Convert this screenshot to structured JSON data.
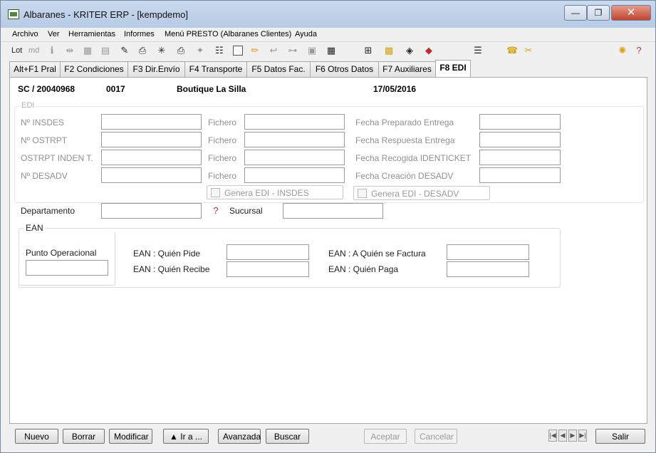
{
  "window": {
    "title": "Albaranes - KRITER ERP -  [kempdemo]",
    "minimize_glyph": "—",
    "restore_glyph": "❐",
    "close_glyph": "✕"
  },
  "menu": [
    "Archivo",
    "Ver",
    "Herramientas",
    "Informes",
    "Menú PRESTO (Albaranes Clientes)",
    "Ayuda"
  ],
  "toolbar": {
    "lot_label": "Lot",
    "md_label": "md"
  },
  "tabs": [
    {
      "label": "Alt+F1 Pral",
      "active": false
    },
    {
      "label": "F2 Condiciones",
      "active": false
    },
    {
      "label": "F3 Dir.Envío",
      "active": false
    },
    {
      "label": "F4 Transporte",
      "active": false
    },
    {
      "label": "F5 Datos Fac.",
      "active": false
    },
    {
      "label": "F6 Otros Datos",
      "active": false
    },
    {
      "label": "F7 Auxiliares",
      "active": false
    },
    {
      "label": "F8 EDI",
      "active": true
    }
  ],
  "header": {
    "document": "SC / 20040968",
    "code": "0017",
    "customer": "Boutique La Silla",
    "date": "17/05/2016"
  },
  "edi": {
    "legend": "EDI",
    "rows": [
      {
        "label": "Nº INSDES",
        "value": "",
        "fichero_label": "Fichero",
        "fichero": "",
        "date_label": "Fecha Preparado Entrega",
        "date": ""
      },
      {
        "label": "Nº OSTRPT",
        "value": "",
        "fichero_label": "Fichero",
        "fichero": "",
        "date_label": "Fecha Respuesta Entrega",
        "date": ""
      },
      {
        "label": "OSTRPT INDEN T.",
        "value": "",
        "fichero_label": "Fichero",
        "fichero": "",
        "date_label": "Fecha Recogida IDENTICKET",
        "date": ""
      },
      {
        "label": "Nº DESADV",
        "value": "",
        "fichero_label": "Fichero",
        "fichero": "",
        "date_label": "Fecha Creación DESADV",
        "date": ""
      }
    ],
    "check_insdes": "Genera EDI - INSDES",
    "check_desadv": "Genera EDI - DESADV"
  },
  "departamento": {
    "label": "Departamento",
    "value": ""
  },
  "sucursal": {
    "label": "Sucursal",
    "value": ""
  },
  "ean": {
    "legend": "EAN",
    "punto_label": "Punto Operacional",
    "punto": "",
    "quien_pide_label": "EAN : Quién Pide",
    "quien_pide": "",
    "quien_recibe_label": "EAN : Quién Recibe",
    "quien_recibe": "",
    "quien_factura_label": "EAN : A Quién se Factura",
    "quien_factura": "",
    "quien_paga_label": "EAN : Quién Paga",
    "quien_paga": ""
  },
  "buttons": {
    "nuevo": "Nuevo",
    "borrar": "Borrar",
    "modificar": "Modificar",
    "ir_a": "▲ Ir a ...",
    "avanzada": "Avanzada",
    "buscar": "Buscar",
    "aceptar": "Aceptar",
    "cancelar": "Cancelar",
    "salir": "Salir"
  },
  "nav": {
    "first": "|◀",
    "prev": "◀",
    "next": "▶",
    "last": "▶|"
  },
  "icons": {
    "help": "help-question-red"
  }
}
